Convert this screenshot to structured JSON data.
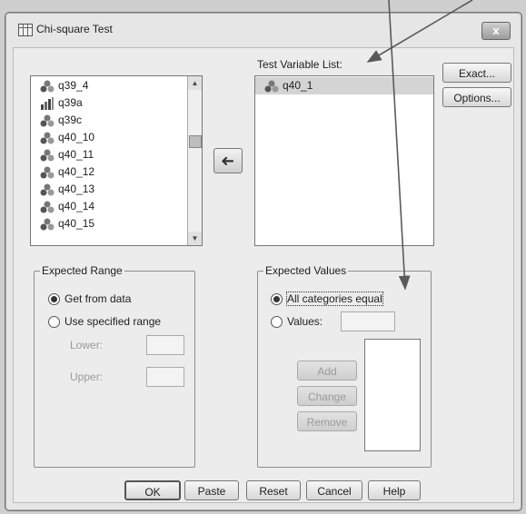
{
  "dialog": {
    "title": "Chi-square Test",
    "close_label": "x"
  },
  "source_list": {
    "items": [
      {
        "name": "q39_4",
        "icon": "nominal-variable-icon"
      },
      {
        "name": "q39a",
        "icon": "scale-variable-icon"
      },
      {
        "name": "q39c",
        "icon": "nominal-variable-icon"
      },
      {
        "name": "q40_10",
        "icon": "nominal-variable-icon"
      },
      {
        "name": "q40_11",
        "icon": "nominal-variable-icon"
      },
      {
        "name": "q40_12",
        "icon": "nominal-variable-icon"
      },
      {
        "name": "q40_13",
        "icon": "nominal-variable-icon"
      },
      {
        "name": "q40_14",
        "icon": "nominal-variable-icon"
      },
      {
        "name": "q40_15",
        "icon": "nominal-variable-icon"
      }
    ]
  },
  "move_arrow": "➜",
  "test_variable_list": {
    "label": "Test Variable List:",
    "items": [
      {
        "name": "q40_1",
        "icon": "nominal-variable-icon"
      }
    ]
  },
  "side_buttons": {
    "exact": "Exact...",
    "options": "Options..."
  },
  "expected_range": {
    "legend": "Expected Range",
    "get_from_data": "Get from data",
    "use_specified": "Use specified range",
    "lower": "Lower:",
    "upper": "Upper:",
    "selected": "get_from_data"
  },
  "expected_values": {
    "legend": "Expected Values",
    "all_equal": "All categories equal",
    "values": "Values:",
    "add": "Add",
    "change": "Change",
    "remove": "Remove",
    "selected": "all_equal"
  },
  "footer": {
    "ok": "OK",
    "paste": "Paste",
    "reset": "Reset",
    "cancel": "Cancel",
    "help": "Help"
  },
  "colors": {
    "annotation_arrow": "#5a5a5a",
    "selected_row": "#d4d4d4"
  }
}
